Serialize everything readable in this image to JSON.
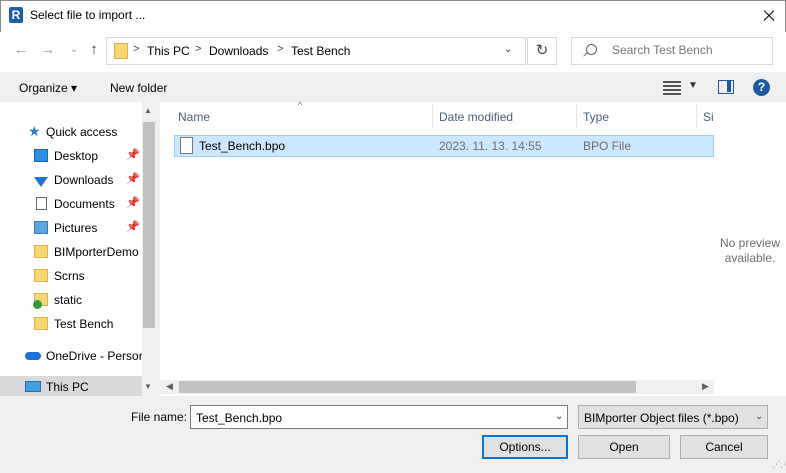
{
  "window": {
    "title": "Select file to import ...",
    "app_icon_letter": "R"
  },
  "address": {
    "crumbs": [
      "This PC",
      "Downloads",
      "Test Bench"
    ],
    "separator": ">"
  },
  "search": {
    "placeholder": "Search Test Bench"
  },
  "toolbar": {
    "organize_label": "Organize ▾",
    "new_folder_label": "New folder",
    "help_glyph": "?"
  },
  "nav": {
    "items": [
      {
        "label": "Quick access",
        "icon": "star-icon",
        "pinned": false
      },
      {
        "label": "Desktop",
        "icon": "desktop-icon",
        "pinned": true
      },
      {
        "label": "Downloads",
        "icon": "download-icon",
        "pinned": true
      },
      {
        "label": "Documents",
        "icon": "documents-icon",
        "pinned": true
      },
      {
        "label": "Pictures",
        "icon": "pictures-icon",
        "pinned": true
      },
      {
        "label": "BIMporterDemo",
        "icon": "folder-icon",
        "pinned": false
      },
      {
        "label": "Scrns",
        "icon": "folder-icon",
        "pinned": false
      },
      {
        "label": "static",
        "icon": "folder-sync-icon",
        "pinned": false
      },
      {
        "label": "Test Bench",
        "icon": "folder-icon",
        "pinned": false
      },
      {
        "label": "OneDrive - Persor",
        "icon": "cloud-icon",
        "pinned": false
      },
      {
        "label": "This PC",
        "icon": "computer-icon",
        "pinned": false
      }
    ]
  },
  "columns": {
    "name": "Name",
    "date_modified": "Date modified",
    "type": "Type",
    "size": "Siz"
  },
  "files": [
    {
      "name": "Test_Bench.bpo",
      "date_modified": "2023. 11. 13. 14:55",
      "type": "BPO File"
    }
  ],
  "preview": {
    "line1": "No preview",
    "line2": "available."
  },
  "bottom": {
    "filename_label": "File name:",
    "filename_value": "Test_Bench.bpo",
    "filetype_value": "BIMporter Object files (*.bpo)",
    "options_label": "Options...",
    "open_label": "Open",
    "cancel_label": "Cancel"
  }
}
